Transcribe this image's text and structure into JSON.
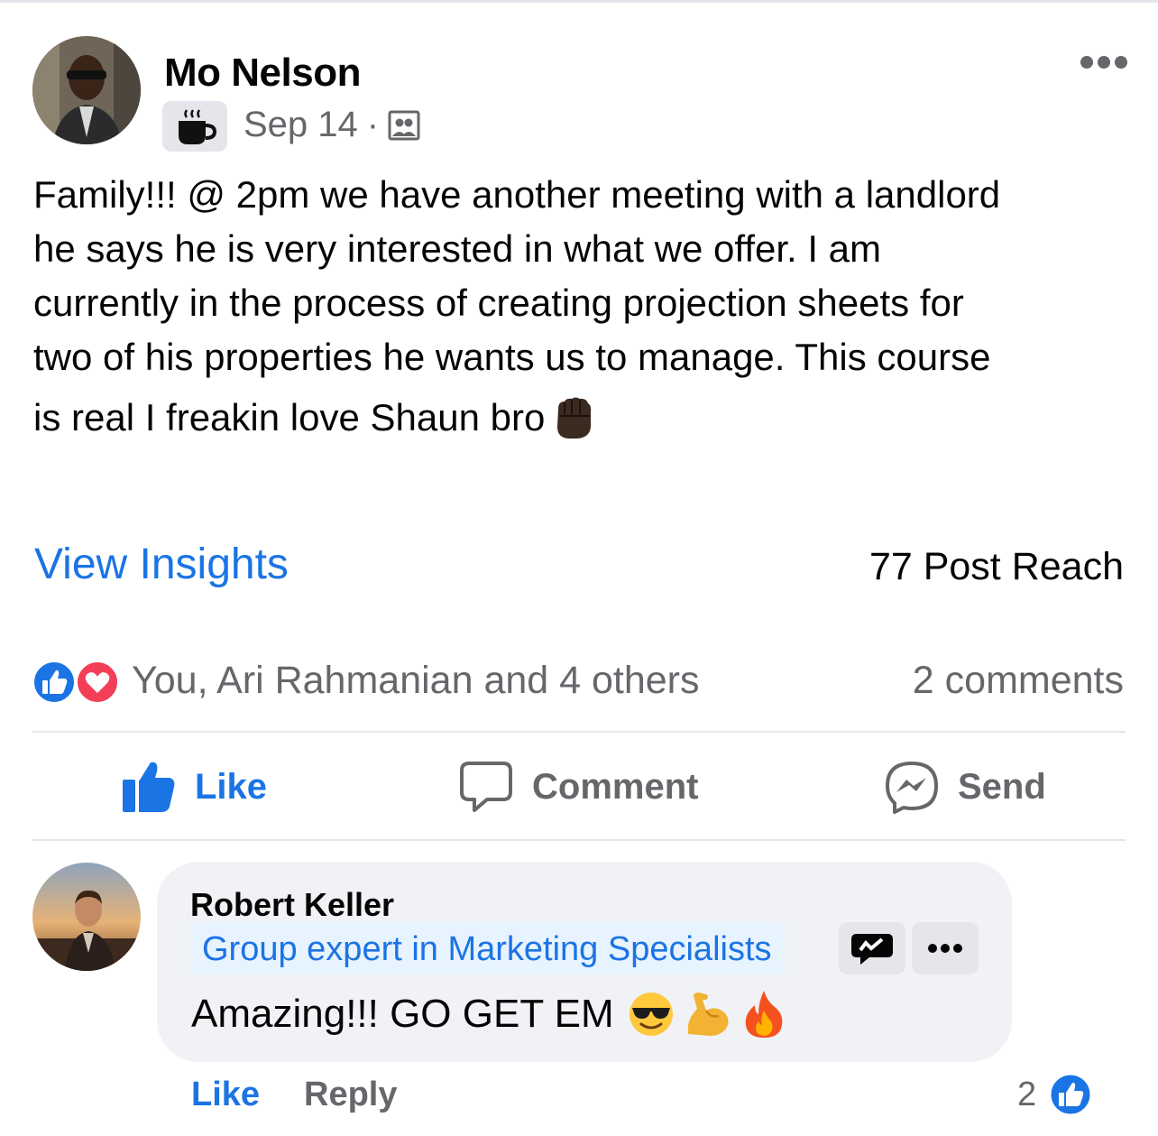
{
  "post": {
    "author": "Mo Nelson",
    "date": "Sep 14",
    "separator": "·",
    "audience_icon": "group-audience-icon",
    "badge_icon": "coffee-cup-icon",
    "more_icon": "more-dots-icon",
    "text_lines": [
      "Family!!! @ 2pm we have another meeting with a landlord",
      "he says he is very interested in what we offer. I am",
      "currently in the process of creating projection sheets for",
      "two of his properties he wants us to manage. This course",
      "is real I freakin love Shaun bro"
    ],
    "text_emoji": "raised-fist-dark-skin-icon"
  },
  "insights": {
    "link": "View Insights",
    "reach": "77 Post Reach"
  },
  "reactions": {
    "icons": [
      "like-reaction-icon",
      "love-reaction-icon"
    ],
    "summary": "You, Ari Rahmanian and 4 others",
    "comments": "2 comments"
  },
  "actions": {
    "like": "Like",
    "comment": "Comment",
    "send": "Send"
  },
  "comment": {
    "author": "Robert Keller",
    "badge": "Group expert in Marketing Specialists",
    "text": "Amazing!!! GO GET EM",
    "emojis": [
      "sunglasses-face-icon",
      "flexed-biceps-icon",
      "fire-icon"
    ],
    "like": "Like",
    "reply": "Reply",
    "like_count": "2"
  },
  "colors": {
    "accent": "#1b74e4",
    "text": "#050505",
    "secondary": "#65676b",
    "bubble": "#f0f2f5",
    "love": "#f33e58"
  }
}
